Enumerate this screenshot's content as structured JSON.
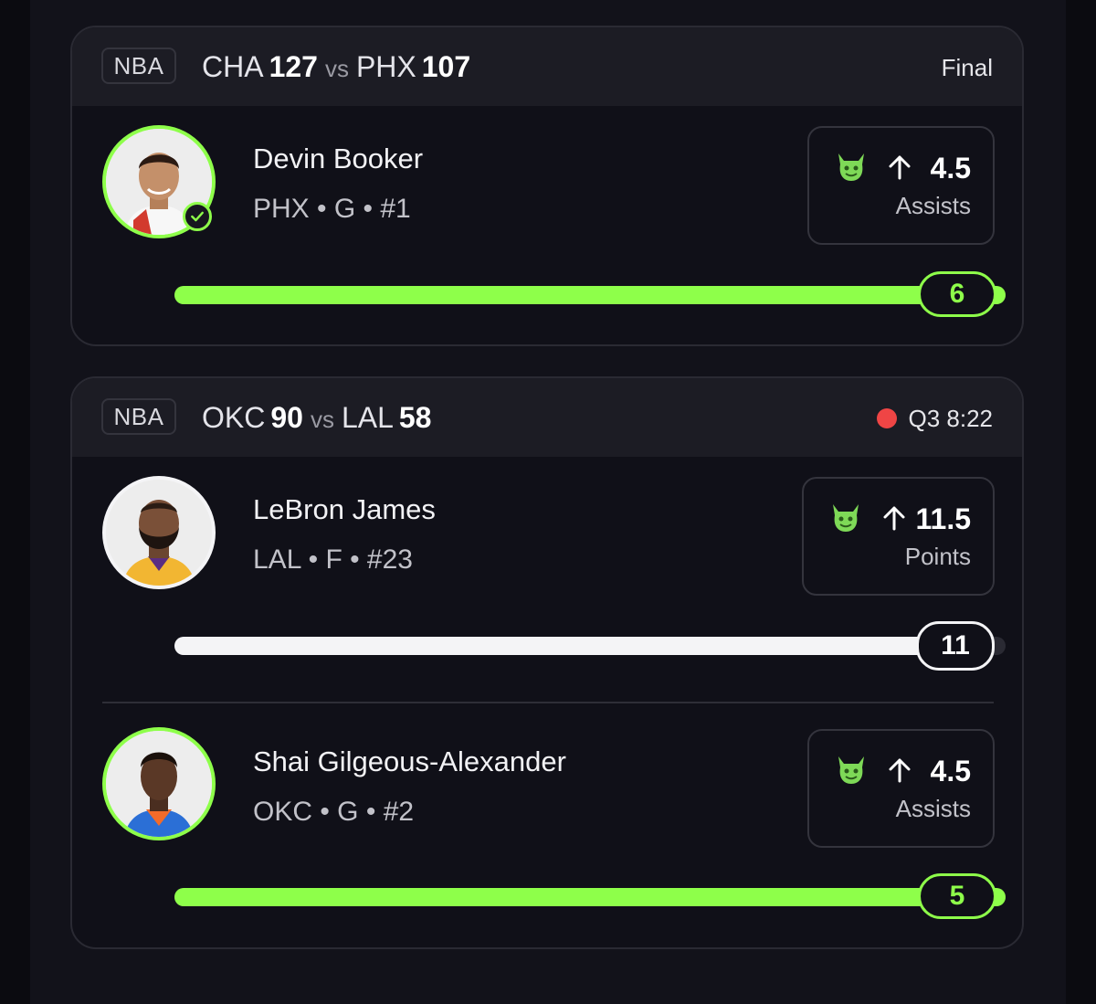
{
  "games": [
    {
      "league": "NBA",
      "team1": "CHA",
      "score1": "127",
      "vs": "vs",
      "team2": "PHX",
      "score2": "107",
      "status": "Final",
      "live": false,
      "players": [
        {
          "name": "Devin Booker",
          "meta": "PHX • G • #1",
          "direction": "up",
          "line": "4.5",
          "stat": "Assists",
          "current": "6",
          "progress": 1.0,
          "bar_color": "#8eff4a",
          "hit": true
        }
      ]
    },
    {
      "league": "NBA",
      "team1": "OKC",
      "score1": "90",
      "vs": "vs",
      "team2": "LAL",
      "score2": "58",
      "status": "Q3 8:22",
      "live": true,
      "players": [
        {
          "name": "LeBron James",
          "meta": "LAL • F • #23",
          "direction": "up",
          "line": "11.5",
          "stat": "Points",
          "current": "11",
          "progress": 0.96,
          "bar_color": "#f4f4f6",
          "hit": false
        },
        {
          "name": "Shai Gilgeous-Alexander",
          "meta": "OKC • G • #2",
          "direction": "up",
          "line": "4.5",
          "stat": "Assists",
          "current": "5",
          "progress": 1.0,
          "bar_color": "#8eff4a",
          "hit": true
        }
      ]
    }
  ],
  "colors": {
    "accent": "#8eff4a",
    "live": "#ef4545",
    "neutral": "#f4f4f6"
  },
  "icons": {
    "mascot": "devil-mascot-icon",
    "direction": "arrow-up-icon",
    "hit": "check-circle-icon",
    "live": "live-dot-icon"
  }
}
